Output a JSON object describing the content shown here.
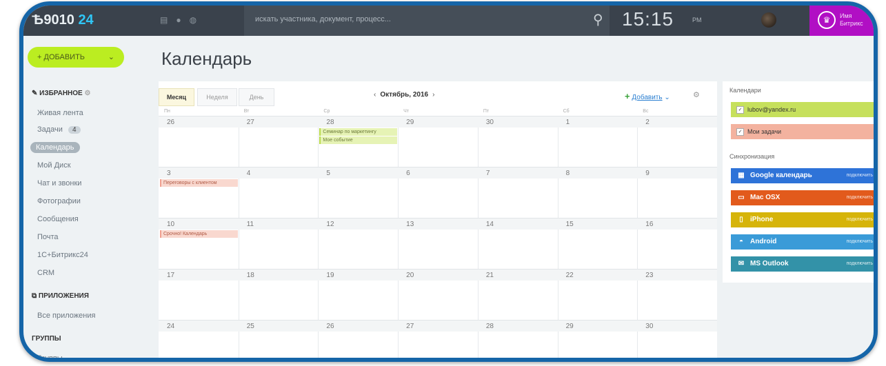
{
  "topbar": {
    "logo_prefix": "Ѣ9010",
    "logo_suffix": "24",
    "search_placeholder": "искать участника, документ, процесс...",
    "clock_time": "15:15",
    "clock_suffix": "PM",
    "user_name_line1": "Имя",
    "user_name_line2": "Битрикс"
  },
  "sidebar": {
    "add_label": "ДОБАВИТЬ",
    "favorites_label": "ИЗБРАННОЕ",
    "items": [
      {
        "label": "Живая лента"
      },
      {
        "label": "Задачи",
        "badge": "4"
      },
      {
        "label": "Календарь",
        "active": true
      },
      {
        "label": "Мой Диск"
      },
      {
        "label": "Чат и звонки"
      },
      {
        "label": "Фотографии"
      },
      {
        "label": "Сообщения"
      },
      {
        "label": "Почта"
      },
      {
        "label": "1С+Битрикс24"
      },
      {
        "label": "CRM"
      }
    ],
    "apps_label": "ПРИЛОЖЕНИЯ",
    "apps_item": "Все приложения",
    "groups_label": "ГРУППЫ",
    "groups_item": "Группы"
  },
  "page_title": "Календарь",
  "calendar": {
    "tabs": [
      "Месяц",
      "Неделя",
      "День"
    ],
    "month_label": "Октябрь, 2016",
    "add_label": "Добавить",
    "weekdays": [
      "Пн",
      "Вт",
      "Ср",
      "Чт",
      "Пт",
      "Сб",
      "Вс"
    ],
    "weeks": [
      [
        "26",
        "27",
        "28",
        "29",
        "30",
        "1",
        "2"
      ],
      [
        "3",
        "4",
        "5",
        "6",
        "7",
        "8",
        "9"
      ],
      [
        "10",
        "11",
        "12",
        "13",
        "14",
        "15",
        "16"
      ],
      [
        "17",
        "18",
        "19",
        "20",
        "21",
        "22",
        "23"
      ],
      [
        "24",
        "25",
        "26",
        "27",
        "28",
        "29",
        "30"
      ]
    ],
    "events": [
      {
        "label": "Семинар по маркетингу",
        "week": 0,
        "day": 2,
        "row": 0,
        "color": "green"
      },
      {
        "label": "Мое событие",
        "week": 0,
        "day": 2,
        "row": 1,
        "color": "green"
      },
      {
        "label": "Переговоры с клиентом",
        "week": 1,
        "day": 0,
        "row": 0,
        "color": "pink"
      },
      {
        "label": "Срочно! Календарь",
        "week": 2,
        "day": 0,
        "row": 0,
        "color": "pink"
      }
    ]
  },
  "right_panel": {
    "calendars_title": "Календари",
    "calendars": [
      {
        "label": "lubov@yandex.ru",
        "color": "#c6e05c"
      },
      {
        "label": "Мои задачи",
        "color": "#f3b29f"
      }
    ],
    "sync_title": "Синхронизация",
    "connect_label": "подключить",
    "sync_items": [
      {
        "label": "Google календарь",
        "color": "#2e73d8",
        "icon": "google-icon"
      },
      {
        "label": "Mac OSX",
        "color": "#e25a1c",
        "icon": "monitor-icon"
      },
      {
        "label": "iPhone",
        "color": "#d6b40a",
        "icon": "phone-icon"
      },
      {
        "label": "Android",
        "color": "#3a9bd8",
        "icon": "android-icon"
      },
      {
        "label": "MS Outlook",
        "color": "#3392a8",
        "icon": "outlook-icon"
      }
    ]
  }
}
